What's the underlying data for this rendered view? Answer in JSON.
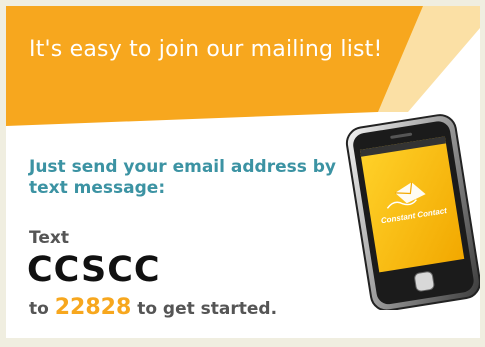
{
  "headline": "It's easy to join our mailing list!",
  "instruction": "Just send your email address by text message:",
  "text_label": "Text",
  "keyword": "CCSCC",
  "to_word": "to",
  "short_code": "22828",
  "suffix": "to get started.",
  "phone": {
    "brand": "Constant Contact"
  },
  "colors": {
    "banner_orange": "#f7a71e",
    "banner_light": "#fbe0a5",
    "headline_text": "#ffffff",
    "instruction_teal": "#3c93a3",
    "body_gray": "#555555",
    "keyword_black": "#111111",
    "short_code_orange": "#f7a71e",
    "phone_screen": "#f6b800"
  }
}
